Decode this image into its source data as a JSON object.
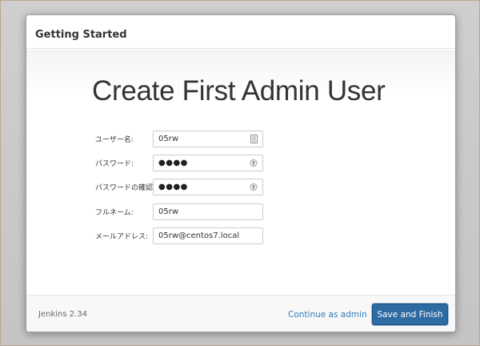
{
  "header": {
    "title": "Getting Started"
  },
  "main": {
    "title": "Create First Admin User"
  },
  "form": {
    "fields": [
      {
        "label": "ユーザー名:",
        "value": "05rw",
        "type": "text",
        "icon": "contact-card-icon"
      },
      {
        "label": "パスワード:",
        "value": "●●●●",
        "type": "password",
        "icon": "password-reveal-icon"
      },
      {
        "label": "パスワードの確認:",
        "value": "●●●●",
        "type": "password",
        "icon": "password-reveal-icon"
      },
      {
        "label": "フルネーム:",
        "value": "05rw",
        "type": "text"
      },
      {
        "label": "メールアドレス:",
        "value": "05rw@centos7.local",
        "type": "text"
      }
    ]
  },
  "footer": {
    "version": "Jenkins 2.34",
    "continue_label": "Continue as admin",
    "save_label": "Save and Finish"
  },
  "colors": {
    "primary_button": "#2e6ba3",
    "link": "#337ab7"
  }
}
